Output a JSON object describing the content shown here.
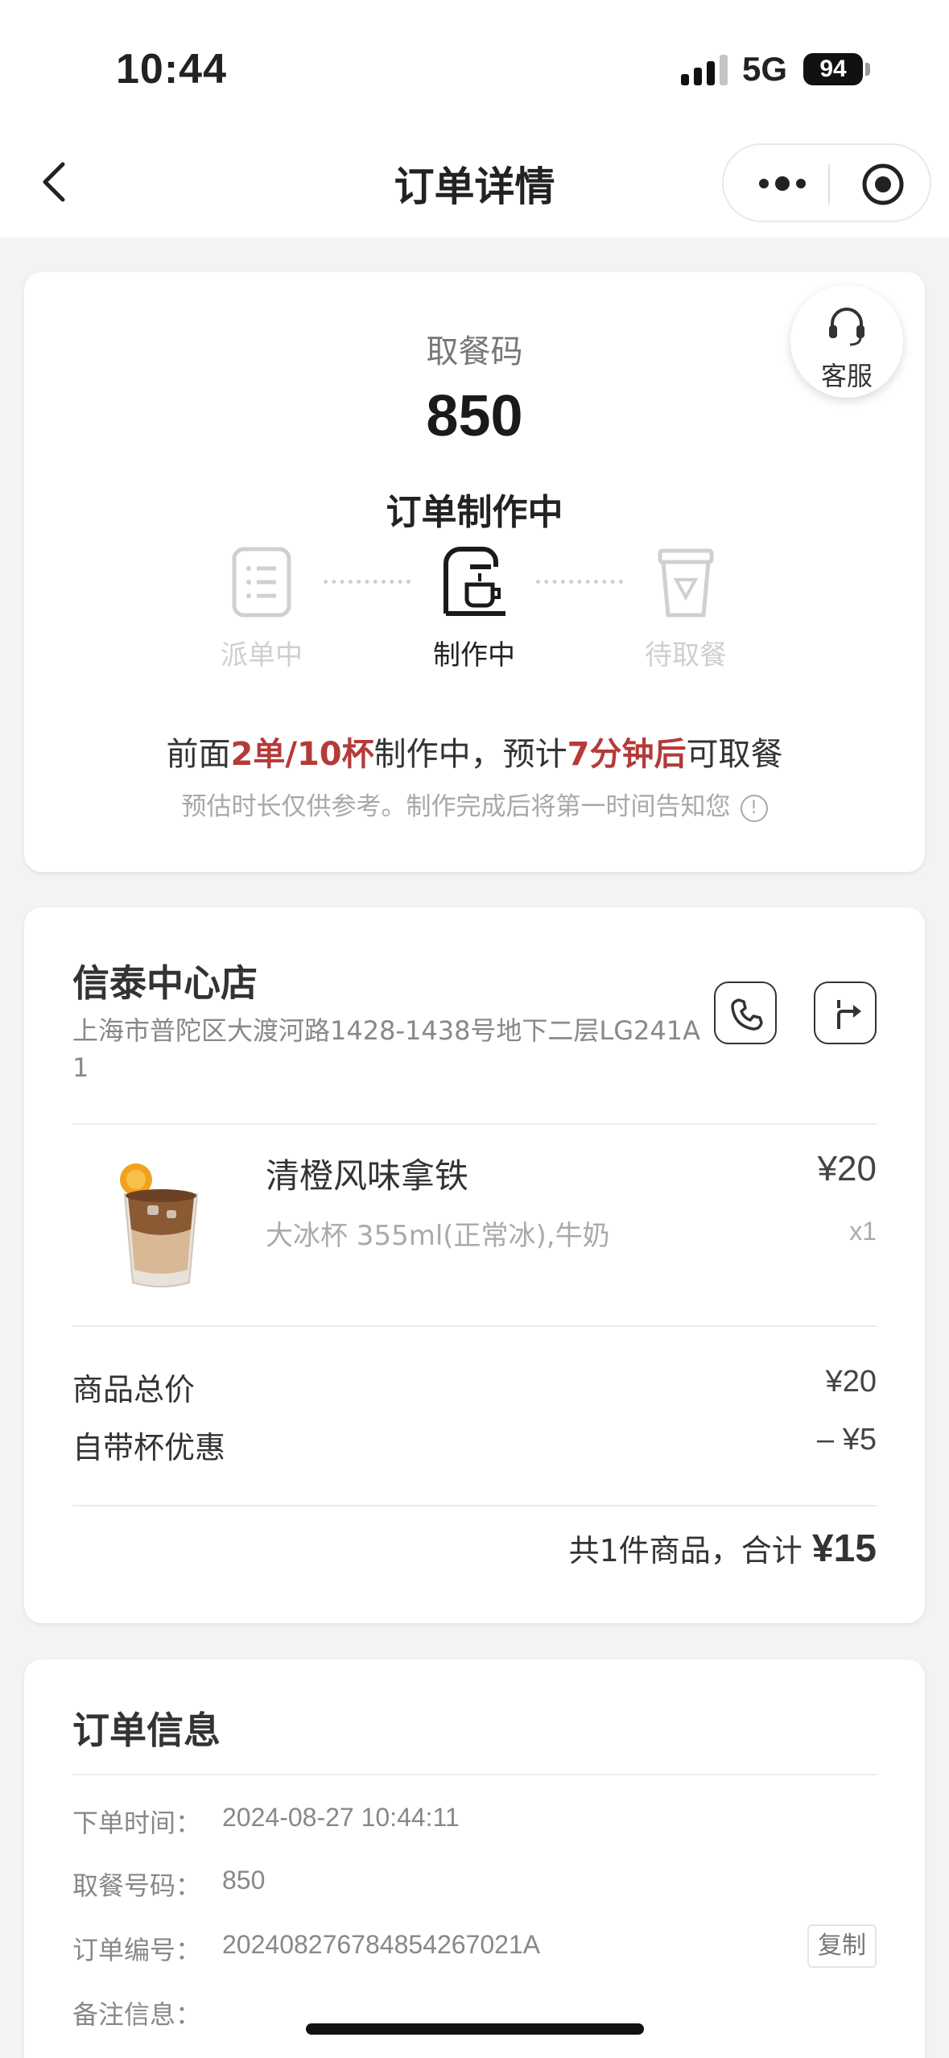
{
  "status_bar": {
    "time": "10:44",
    "network": "5G",
    "battery": "94"
  },
  "nav": {
    "title": "订单详情"
  },
  "order_status": {
    "service_label": "客服",
    "pickup_label": "取餐码",
    "pickup_code": "850",
    "status_title": "订单制作中",
    "steps": [
      {
        "label": "派单中",
        "icon": "receipt-list-icon",
        "active": false
      },
      {
        "label": "制作中",
        "icon": "coffee-machine-icon",
        "active": true
      },
      {
        "label": "待取餐",
        "icon": "cup-icon",
        "active": false
      }
    ],
    "eta": {
      "prefix": "前面",
      "queue": "2单/10杯",
      "middle": "制作中，预计",
      "time": "7分钟后",
      "suffix": "可取餐"
    },
    "eta_note": "预估时长仅供参考。制作完成后将第一时间告知您",
    "accent_color": "#b53a3a"
  },
  "store": {
    "name": "信泰中心店",
    "address": "上海市普陀区大渡河路1428-1438号地下二层LG241A1",
    "actions": [
      "phone-icon",
      "directions-icon"
    ]
  },
  "product": {
    "name": "清橙风味拿铁",
    "spec": "大冰杯 355ml(正常冰),牛奶",
    "price": "¥20",
    "qty": "x1"
  },
  "summary": {
    "subtotal_label": "商品总价",
    "subtotal_value": "¥20",
    "discount_label": "自带杯优惠",
    "discount_value": "– ¥5",
    "total_prefix": "共1件商品，合计",
    "total_value": "¥15"
  },
  "order_info": {
    "title": "订单信息",
    "rows": [
      {
        "label": "下单时间：",
        "value": "2024-08-27 10:44:11"
      },
      {
        "label": "取餐号码：",
        "value": "850"
      },
      {
        "label": "订单编号：",
        "value": "20240827678485426702​1A"
      },
      {
        "label": "备注信息：",
        "value": ""
      }
    ],
    "copy_label": "复制"
  }
}
